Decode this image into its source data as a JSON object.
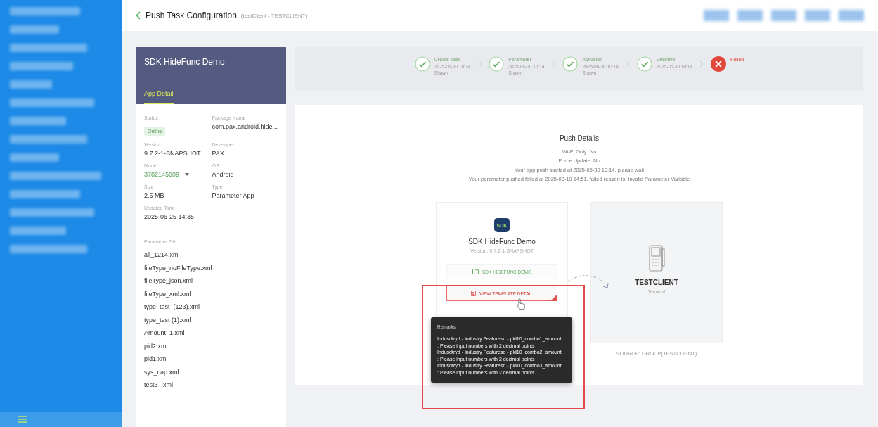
{
  "header": {
    "title": "Push Task Configuration",
    "subtitle": "(testClient - TESTCLIENT)"
  },
  "app_card": {
    "name": "SDK HideFunc Demo",
    "tabs": [
      {
        "label": "App Detail",
        "selected": true
      }
    ],
    "fields": [
      {
        "label": "Status",
        "value": "Online",
        "kind": "badge"
      },
      {
        "label": "Package Name",
        "value": "com.pax.android.hide...",
        "kind": "text"
      },
      {
        "label": "Version",
        "value": "9.7.2-1-SNAPSHOT",
        "kind": "text"
      },
      {
        "label": "Developer",
        "value": "PAX",
        "kind": "text"
      },
      {
        "label": "Model",
        "value": "3782145609",
        "kind": "select"
      },
      {
        "label": "OS",
        "value": "Android",
        "kind": "text"
      },
      {
        "label": "Size",
        "value": "2.5 MB",
        "kind": "text"
      },
      {
        "label": "Type",
        "value": "Parameter App",
        "kind": "text"
      },
      {
        "label": "Updated Time",
        "value": "2025-06-25 14:35",
        "kind": "text"
      }
    ],
    "parameter_file": {
      "label": "Parameter File",
      "files": [
        "all_1214.xml",
        "fileType_noFileType.xml",
        "fileType_json.xml",
        "fileType_xml.xml",
        "type_test_(123).xml",
        "type_test (1).xml",
        "Amount_1.xml",
        "pid2.xml",
        "pid1.xml",
        "sys_cap.xml",
        "test3_.xml"
      ]
    }
  },
  "steps": [
    {
      "title": "Create Task",
      "time": "2025-06-30 10:14",
      "user": "Shawn",
      "failed": false
    },
    {
      "title": "Parameter",
      "time": "2025-06-30 10:14",
      "user": "Shawn",
      "failed": false
    },
    {
      "title": "Activated",
      "time": "2025-06-30 10:14",
      "user": "Shawn",
      "failed": false
    },
    {
      "title": "Effective",
      "time": "2025-06-30 10:14",
      "failed": false
    },
    {
      "title": "Failed",
      "failed": true
    }
  ],
  "push_details": {
    "title": "Push Details",
    "lines": [
      "Wi-Fi Only: No",
      "Force Update: No",
      "Your app push started at 2025-06-30 10:14, please wait",
      "Your parameter pushed failed at 2025-08-19 14:51, failed reason is: Invalid Parameter Variable"
    ]
  },
  "source_app": {
    "icon_text": "SDK",
    "name": "SDK HideFunc Demo",
    "version": "Version: 9.7.2-1-SNAPSHOT",
    "template_button": "SDK HIDEFUNC DEMO",
    "detail_button": "VIEW TEMPLATE DETAIL"
  },
  "target": {
    "name": "TESTCLIENT",
    "type": "Terminal",
    "source": "SOURCE: GROUP(TESTCLIENT)"
  },
  "tooltip": {
    "title": "Remarks",
    "lines": [
      "Indusdtryd - Industry Featuresd - pid10_combo1_amount : Please input numbers with 2 decimal points",
      "Indusdtryd - Industry Featuresd - pid10_combo2_amount : Please input numbers with 2 decimal points",
      "Indusdtryd - Industry Featuresd - pid10_combo3_amount : Please input numbers with 2 decimal points"
    ]
  }
}
